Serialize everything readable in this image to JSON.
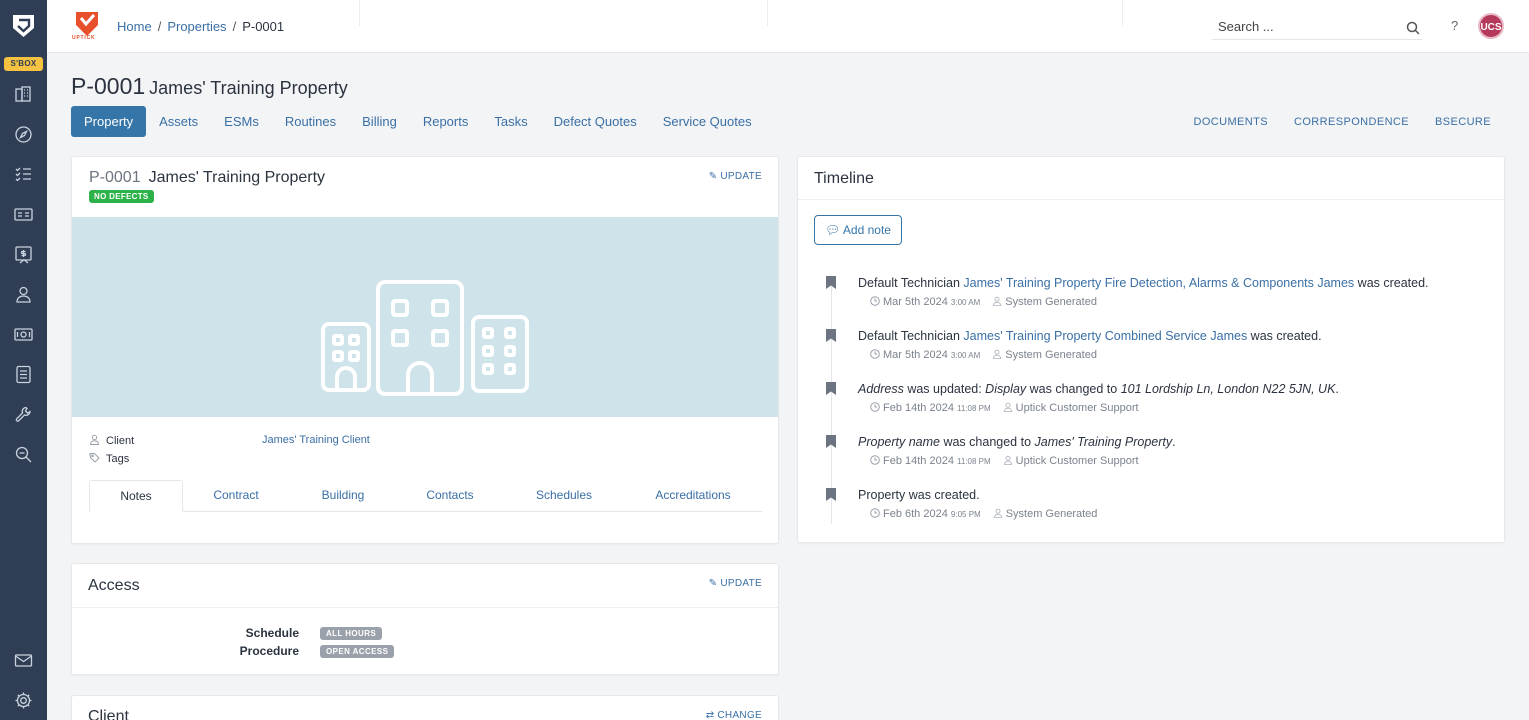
{
  "sidebar": {
    "sbox_label": "S'BOX",
    "icons": [
      "property-icon",
      "compass-icon",
      "checklist-icon",
      "id-card-icon",
      "invoice-icon",
      "user-icon",
      "money-icon",
      "file-icon",
      "wrench-icon",
      "search-doc-icon",
      "mail-icon",
      "settings-icon"
    ]
  },
  "topbar": {
    "brand_text": "UPTICK",
    "breadcrumb": [
      "Home",
      "Properties",
      "P-0001"
    ],
    "search_placeholder": "Search ...",
    "help": "?",
    "avatar_initials": "UCS"
  },
  "page": {
    "code": "P-0001",
    "name": "James' Training Property"
  },
  "tabs": [
    "Property",
    "Assets",
    "ESMs",
    "Routines",
    "Billing",
    "Reports",
    "Tasks",
    "Defect Quotes",
    "Service Quotes"
  ],
  "toplinks": [
    "DOCUMENTS",
    "CORRESPONDENCE",
    "BSECURE"
  ],
  "property_card": {
    "code": "P-0001",
    "name": "James' Training Property",
    "badge": "NO DEFECTS",
    "update": "UPDATE",
    "client_label": "Client",
    "client_value": "James' Training Client",
    "tags_label": "Tags",
    "subtabs": [
      "Notes",
      "Contract",
      "Building",
      "Contacts",
      "Schedules",
      "Accreditations"
    ]
  },
  "access_card": {
    "title": "Access",
    "update": "UPDATE",
    "schedule_label": "Schedule",
    "schedule_value": "ALL HOURS",
    "procedure_label": "Procedure",
    "procedure_value": "OPEN ACCESS"
  },
  "client_card": {
    "title": "Client",
    "change": "CHANGE"
  },
  "timeline": {
    "title": "Timeline",
    "add_note": "Add note",
    "items": [
      {
        "pre": "Default Technician ",
        "link1": "James' Training Property",
        "link2": "Fire Detection, Alarms & Components",
        "link3": "James",
        "post": " was created.",
        "date": "Mar 5th 2024",
        "time": "3:00 AM",
        "user": "System Generated"
      },
      {
        "pre": "Default Technician ",
        "link1": "James' Training Property",
        "link2": "Combined Service",
        "link3": "James",
        "post": " was created.",
        "date": "Mar 5th 2024",
        "time": "3:00 AM",
        "user": "System Generated"
      },
      {
        "field": "Address",
        "mid1": " was updated: ",
        "sub": "Display",
        "mid2": " was changed to ",
        "value": "101 Lordship Ln, London N22 5JN, UK",
        "end": ".",
        "date": "Feb 14th 2024",
        "time": "11:08 PM",
        "user": "Uptick Customer Support"
      },
      {
        "field": "Property name",
        "mid": " was changed to ",
        "value": "James' Training Property",
        "end": ".",
        "date": "Feb 14th 2024",
        "time": "11:08 PM",
        "user": "Uptick Customer Support"
      },
      {
        "text": "Property was created.",
        "date": "Feb 6th 2024",
        "time": "9:05 PM",
        "user": "System Generated"
      }
    ]
  }
}
